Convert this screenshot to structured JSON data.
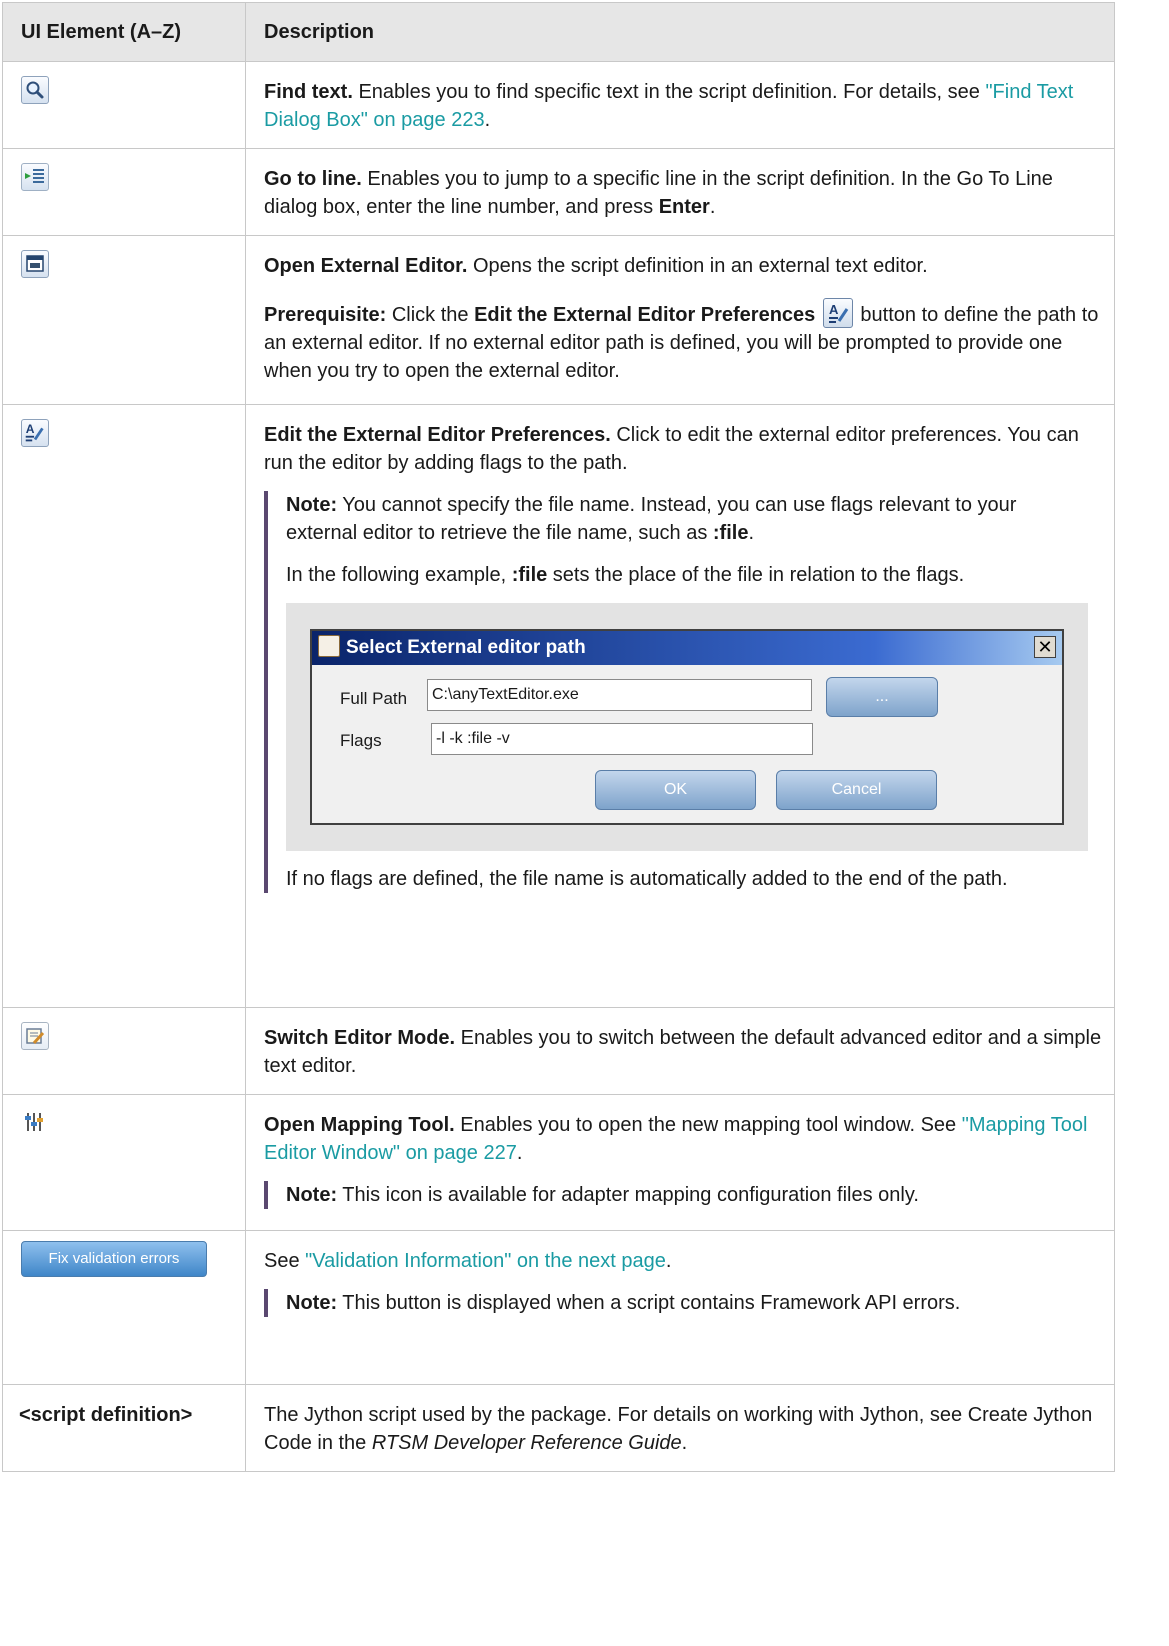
{
  "table": {
    "headers": [
      "UI Element (A–Z)",
      "Description"
    ]
  },
  "rows": {
    "find": {
      "icon": "magnifier-icon",
      "title": "Find text.",
      "text": " Enables you to find specific text in the script definition. For details, see ",
      "link": "\"Find Text Dialog Box\" on page 223",
      "end": "."
    },
    "goto": {
      "icon": "go-to-line-icon",
      "title": "Go to line.",
      "text": " Enables you to jump to a specific line in the script definition. In the Go To Line dialog box, enter the line number, and press ",
      "bold_end": "Enter",
      "end": "."
    },
    "open_ext": {
      "icon": "external-editor-icon",
      "title": "Open External Editor.",
      "text": " Opens the script definition in an external text editor.",
      "prereq_label": "Prerequisite:",
      "prereq_a": " Click the ",
      "prereq_bold": "Edit the External Editor Preferences",
      "prereq_b": " button to define the path to an external editor. If no external editor path is defined, you will be prompted to provide one when you try to open the external editor."
    },
    "edit_pref": {
      "icon": "editor-preferences-icon",
      "title": "Edit the External Editor Preferences.",
      "text": " Click to edit the external editor preferences. You can run the editor by adding flags to the path.",
      "note_label": "Note:",
      "note_text": "  You cannot specify the file name. Instead, you can use flags relevant to your external editor to retrieve the file name, such as ",
      "note_bold": ":file",
      "note_end": ".",
      "example_a": "In the following example, ",
      "example_bold": ":file",
      "example_b": " sets the place of the file in relation to the flags.",
      "after": "If no flags are defined, the file name is automatically added to the end of the path."
    },
    "switch": {
      "icon": "switch-editor-mode-icon",
      "title": "Switch Editor Mode.",
      "text": " Enables you to switch between the default advanced editor and a simple text editor."
    },
    "mapping": {
      "icon": "mapping-tool-icon",
      "title": "Open Mapping Tool.",
      "text": " Enables you to open the new mapping tool window. See ",
      "link": "\"Mapping Tool Editor Window\" on page 227",
      "end": ".",
      "note_label": "Note:",
      "note_text": " This icon is available for adapter mapping configuration files only."
    },
    "fix": {
      "button_label": "Fix validation errors",
      "text": "See ",
      "link": "\"Validation Information\" on the next page",
      "end": ".",
      "note_label": "Note:",
      "note_text": "  This button is displayed when a script contains Framework API errors."
    },
    "script": {
      "element": "<script definition>",
      "text": "The Jython script used by the package. For details on working with Jython, see Create Jython Code in the ",
      "italic": "RTSM Developer Reference Guide",
      "end": "."
    }
  },
  "dialog": {
    "title": "Select External editor path",
    "close": "✕",
    "full_path_label": "Full Path",
    "full_path_value": "C:\\anyTextEditor.exe",
    "browse_label": "...",
    "flags_label": "Flags",
    "flags_value": "-l -k :file -v",
    "ok_label": "OK",
    "cancel_label": "Cancel"
  }
}
